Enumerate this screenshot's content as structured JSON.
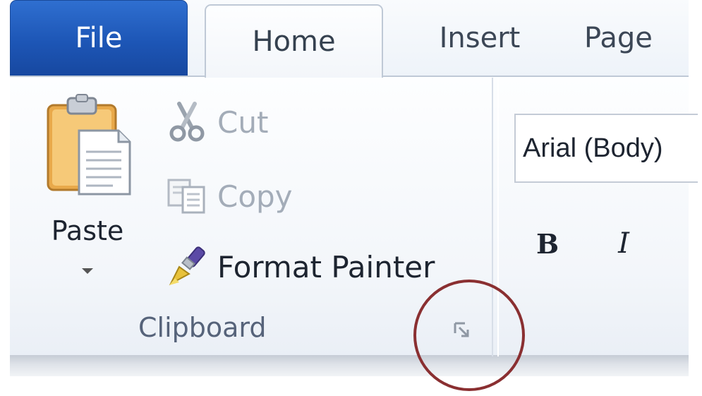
{
  "tabs": {
    "file": "File",
    "home": "Home",
    "insert": "Insert",
    "page_layout": "Page"
  },
  "clipboard": {
    "paste_label": "Paste",
    "cut_label": "Cut",
    "copy_label": "Copy",
    "format_painter_label": "Format Painter",
    "group_label": "Clipboard"
  },
  "font": {
    "font_name": "Arial (Body)",
    "bold_label": "B",
    "italic_label": "I"
  },
  "colors": {
    "file_tab": "#1d56b6",
    "annotation_circle": "#8a2f31"
  },
  "icons": {
    "paste": "clipboard-paste-icon",
    "cut": "scissors-icon",
    "copy": "copy-icon",
    "format_painter": "paintbrush-icon",
    "launcher": "dialog-launcher-icon",
    "paste_dropdown": "caret-down-icon"
  }
}
